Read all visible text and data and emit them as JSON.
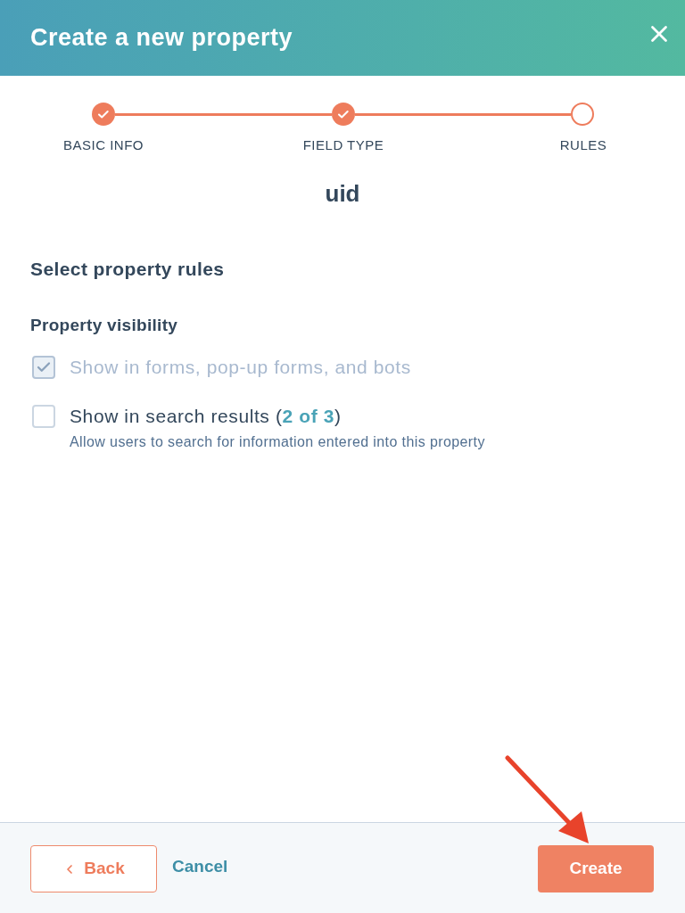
{
  "header": {
    "title": "Create a new property"
  },
  "steps": [
    {
      "label": "BASIC INFO",
      "completed": true
    },
    {
      "label": "FIELD TYPE",
      "completed": true
    },
    {
      "label": "RULES",
      "completed": false
    }
  ],
  "property_name": "uid",
  "section_title": "Select property rules",
  "visibility": {
    "heading": "Property visibility",
    "options": [
      {
        "label": "Show in forms, pop-up forms, and bots",
        "checked": true,
        "disabled": true
      },
      {
        "label": "Show in search results (**2 of 3**)",
        "checked": false,
        "disabled": false,
        "description": "Allow users to search for information entered into this property"
      }
    ]
  },
  "footer": {
    "back_button": "Back",
    "cancel_link": "Cancel",
    "create_button": "Create"
  }
}
